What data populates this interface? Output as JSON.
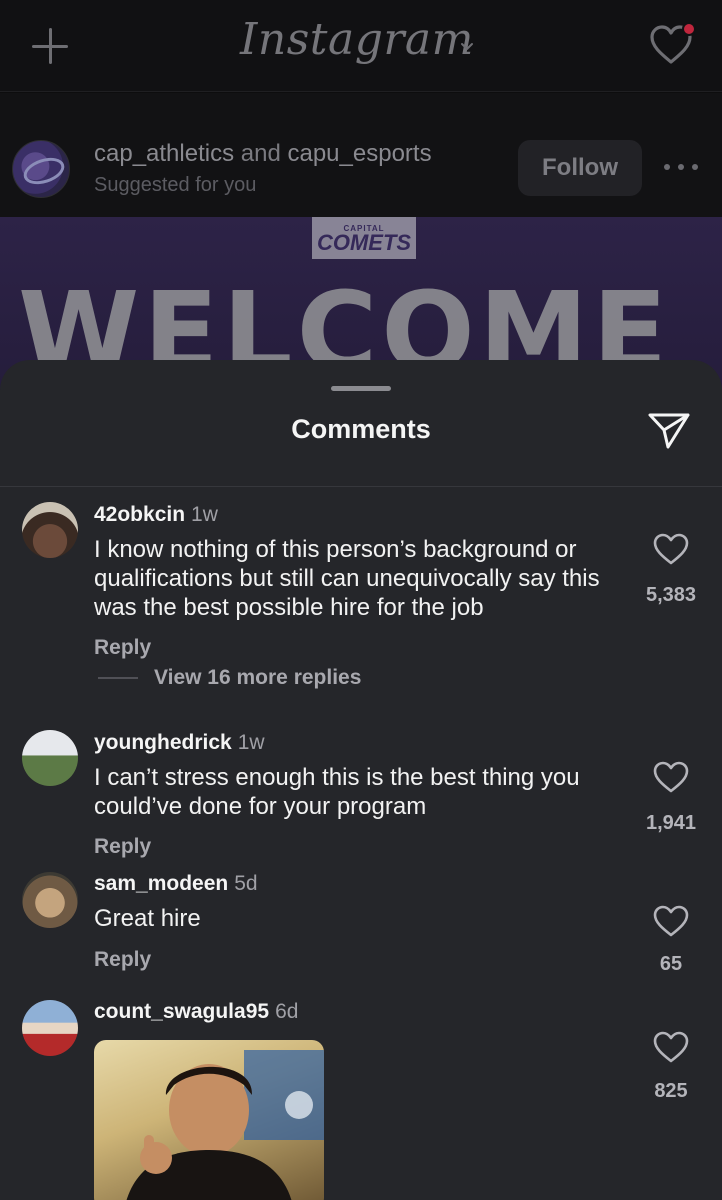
{
  "app": {
    "logo_text": "Instagram"
  },
  "post": {
    "user_primary": "cap_athletics",
    "and_text": "and",
    "user_secondary": "capu_esports",
    "subtitle": "Suggested for you",
    "follow_label": "Follow",
    "badge_small": "CAPITAL",
    "badge_big": "COMETS",
    "image_text": "WELCOME"
  },
  "comments_sheet": {
    "title": "Comments",
    "comments": [
      {
        "username": "42obkcin",
        "time": "1w",
        "text": "I know nothing of this person’s background or qualifications but still can unequivocally say this was the best possible hire for the job",
        "reply_label": "Reply",
        "likes": "5,383",
        "view_more": "View 16 more replies"
      },
      {
        "username": "younghedrick",
        "time": "1w",
        "text": "I can’t stress enough this is the best thing you could’ve done for your program",
        "reply_label": "Reply",
        "likes": "1,941"
      },
      {
        "username": "sam_modeen",
        "time": "5d",
        "text": "Great hire",
        "reply_label": "Reply",
        "likes": "65"
      },
      {
        "username": "count_swagula95",
        "time": "6d",
        "likes": "825"
      }
    ]
  },
  "colors": {
    "sheet_bg": "#25262a",
    "accent_notification": "#c0263d",
    "post_image_bg": "#2d2347"
  },
  "icons": [
    "plus-icon",
    "chevron-down-icon",
    "heart-icon",
    "more-icon",
    "send-icon",
    "like-heart-icon"
  ]
}
